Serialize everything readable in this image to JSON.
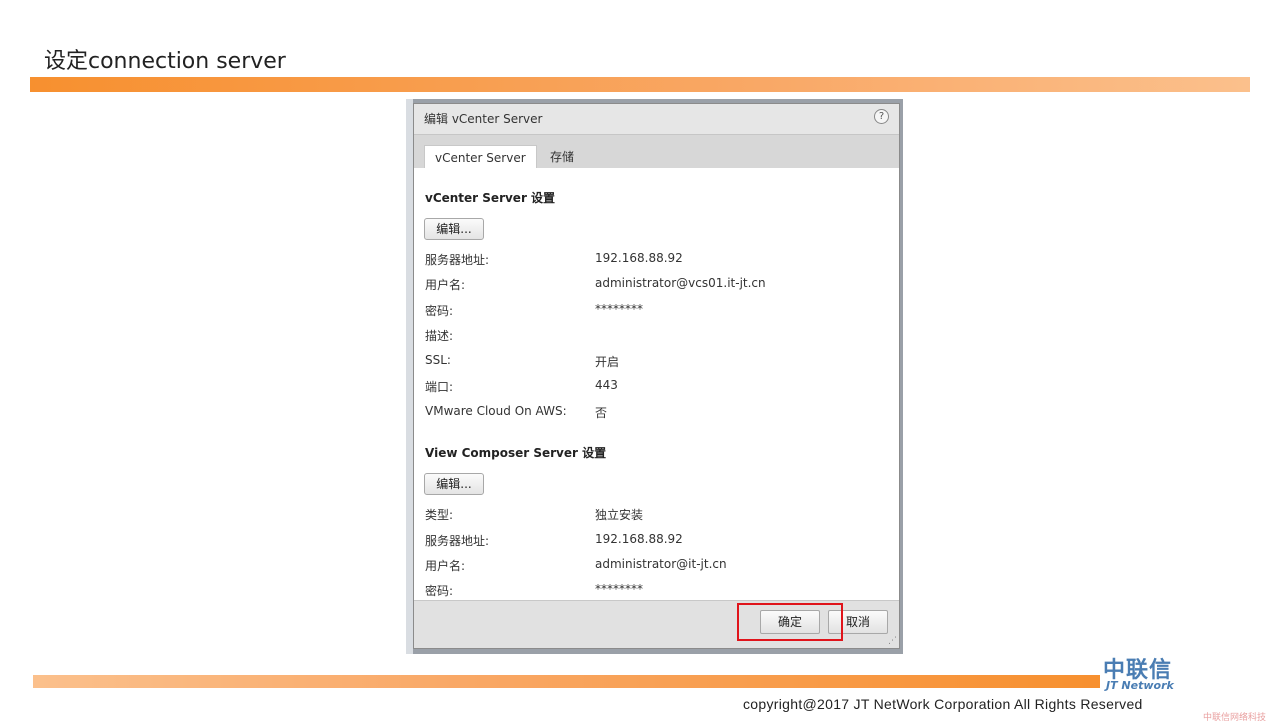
{
  "slide": {
    "title": "设定connection server",
    "copyright": "copyright@2017  JT NetWork Corporation All Rights Reserved",
    "logo_cn": "中联信",
    "logo_en": "JT Network",
    "watermark": "中联信网络科技"
  },
  "dialog": {
    "title": "编辑 vCenter Server",
    "help": "?",
    "tabs": [
      {
        "label": "vCenter Server",
        "active": true
      },
      {
        "label": "存储",
        "active": false
      }
    ],
    "vcenter_section": {
      "heading": "vCenter Server 设置",
      "edit_label": "编辑...",
      "rows": [
        {
          "label": "服务器地址:",
          "value": "192.168.88.92"
        },
        {
          "label": "用户名:",
          "value": "administrator@vcs01.it-jt.cn"
        },
        {
          "label": "密码:",
          "value": "********"
        },
        {
          "label": "描述:",
          "value": ""
        },
        {
          "label": "SSL:",
          "value": "开启"
        },
        {
          "label": "端口:",
          "value": "443"
        },
        {
          "label": "VMware Cloud On AWS:",
          "value": "否"
        }
      ]
    },
    "composer_section": {
      "heading": "View Composer Server 设置",
      "edit_label": "编辑...",
      "rows": [
        {
          "label": "类型:",
          "value": "独立安装"
        },
        {
          "label": "服务器地址:",
          "value": "192.168.88.92"
        },
        {
          "label": "用户名:",
          "value": "administrator@it-jt.cn"
        },
        {
          "label": "密码:",
          "value": "********"
        }
      ]
    },
    "ok_label": "确定",
    "cancel_label": "取消"
  }
}
